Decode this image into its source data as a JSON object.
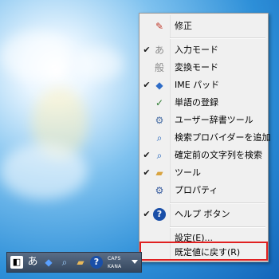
{
  "menu": {
    "items": [
      {
        "check": "",
        "icon": "edit-icon",
        "icon_char": "✎",
        "icon_color": "#c0392b",
        "label": "修正"
      },
      {
        "check": "✔",
        "icon": "hiragana-a-icon",
        "icon_char": "あ",
        "icon_color": "#8a8a8a",
        "label": "入力モード"
      },
      {
        "check": "",
        "icon": "kanji-convert-icon",
        "icon_char": "般",
        "icon_color": "#8a8a8a",
        "label": "変換モード"
      },
      {
        "check": "✔",
        "icon": "ime-pad-icon",
        "icon_char": "◆",
        "icon_color": "#2e6cc7",
        "label": "IME パッド"
      },
      {
        "check": "",
        "icon": "word-register-icon",
        "icon_char": "✓",
        "icon_color": "#2e7d32",
        "label": "単語の登録"
      },
      {
        "check": "",
        "icon": "user-dictionary-icon",
        "icon_char": "⚙",
        "icon_color": "#4a6fa5",
        "label": "ユーザー辞書ツール"
      },
      {
        "check": "",
        "icon": "search-provider-icon",
        "icon_char": "⌕",
        "icon_color": "#1c5fb8",
        "label": "検索プロバイダーを追加"
      },
      {
        "check": "✔",
        "icon": "search-text-icon",
        "icon_char": "⌕",
        "icon_color": "#1c5fb8",
        "label": "確定前の文字列を検索"
      },
      {
        "check": "✔",
        "icon": "tools-icon",
        "icon_char": "▰",
        "icon_color": "#d9a441",
        "label": "ツール"
      },
      {
        "check": "",
        "icon": "properties-icon",
        "icon_char": "⚙",
        "icon_color": "#3b5fa0",
        "label": "プロパティ"
      },
      {
        "check": "✔",
        "icon": "help-icon",
        "icon_char": "?",
        "icon_color": "#1a4fa8",
        "label": "ヘルプ ボタン"
      },
      {
        "check": "",
        "icon": "",
        "icon_char": "",
        "icon_color": "",
        "label": "設定(E)..."
      },
      {
        "check": "",
        "icon": "",
        "icon_char": "",
        "icon_color": "",
        "label": "既定値に戻す(R)"
      }
    ]
  },
  "taskbar": {
    "icons": [
      {
        "icon": "ime-mode-icon",
        "char": "◧"
      },
      {
        "icon": "hiragana-a-icon",
        "char": "あ"
      },
      {
        "icon": "ime-pad-icon",
        "char": "◆"
      },
      {
        "icon": "search-icon",
        "char": "⌕"
      },
      {
        "icon": "tools-icon",
        "char": "▰"
      },
      {
        "icon": "help-icon",
        "char": "?"
      }
    ],
    "caps_label": "CAPS",
    "kana_label": "KANA"
  },
  "colors": {
    "highlight_border": "#e02020",
    "menu_background": "#f0f0f0",
    "taskbar_background": "#3e516a"
  }
}
